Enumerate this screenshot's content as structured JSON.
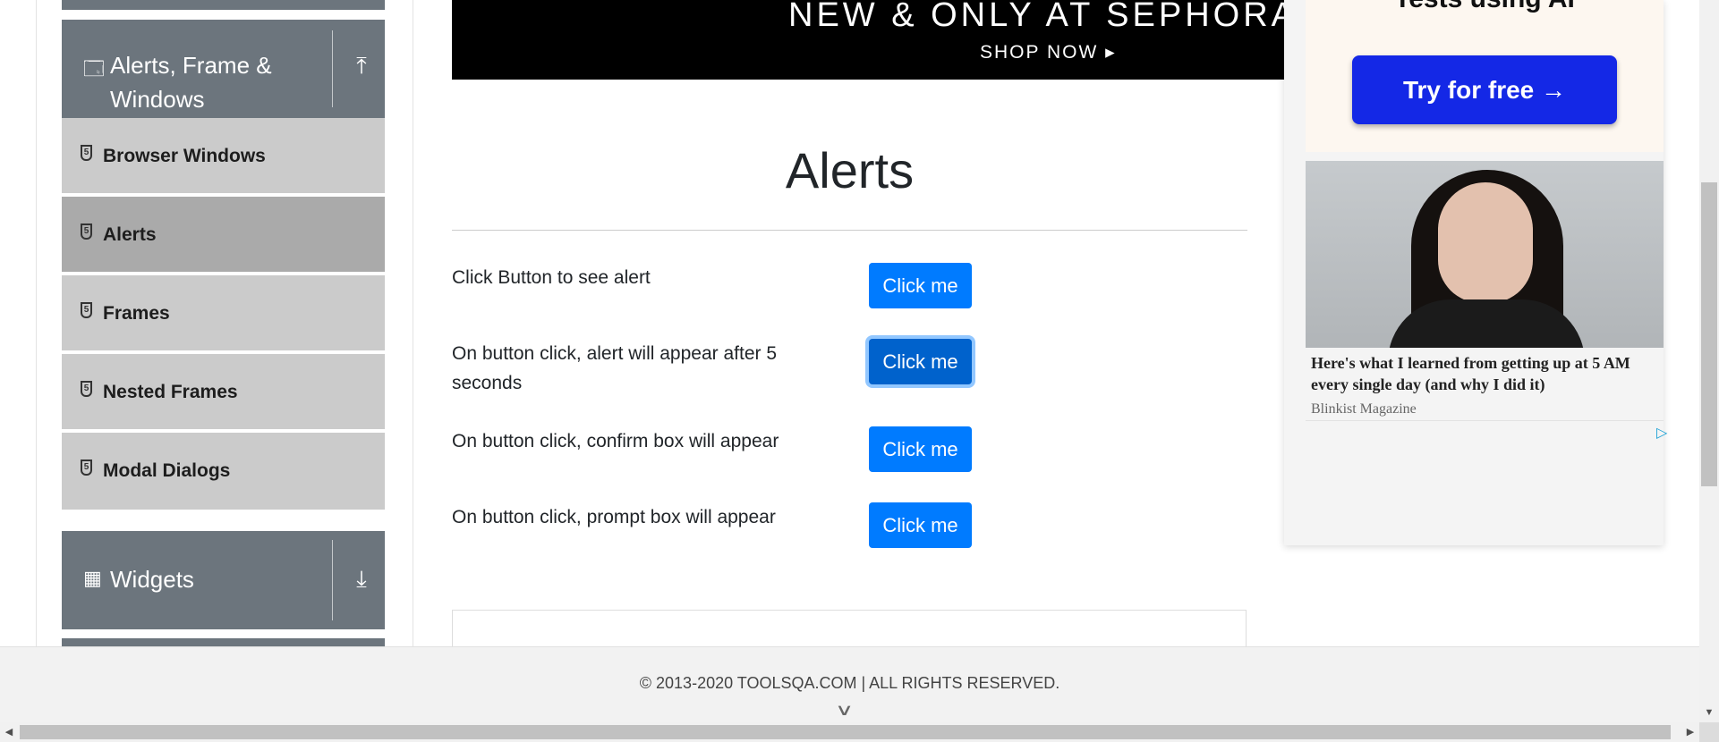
{
  "sidebar": {
    "group_alerts": {
      "label": "Alerts, Frame & Windows",
      "line1": "Alerts, Frame &",
      "line2": "Windows",
      "icon": "window-icon",
      "toggle": "upload-arrow-icon"
    },
    "items": [
      {
        "label": "Browser Windows",
        "icon": "html5-shield-icon",
        "active": false
      },
      {
        "label": "Alerts",
        "icon": "html5-shield-icon",
        "active": true
      },
      {
        "label": "Frames",
        "icon": "html5-shield-icon",
        "active": false
      },
      {
        "label": "Nested Frames",
        "icon": "html5-shield-icon",
        "active": false
      },
      {
        "label": "Modal Dialogs",
        "icon": "html5-shield-icon",
        "active": false
      }
    ],
    "group_widgets": {
      "label": "Widgets",
      "icon": "widgets-icon",
      "toggle": "download-arrow-icon"
    }
  },
  "banner": {
    "line1": "NEW & ONLY AT SEPHORA",
    "line2": "SHOP NOW ▸"
  },
  "main": {
    "title": "Alerts",
    "rows": [
      {
        "text": "Click Button to see alert",
        "button": "Click me"
      },
      {
        "text": "On button click, alert will appear after 5 seconds",
        "button": "Click me"
      },
      {
        "text": "On button click, confirm box will appear",
        "button": "Click me"
      },
      {
        "text": "On button click, prompt box will appear",
        "button": "Click me"
      }
    ]
  },
  "ad": {
    "heading": "Tests using AI",
    "cta": "Try for free →",
    "headline": "Here's what I learned from getting up at 5 AM every single day (and why I did it)",
    "source": "Blinkist Magazine",
    "choice_icon": "adchoices-icon"
  },
  "footer": {
    "text": "© 2013-2020 TOOLSQA.COM | ALL RIGHTS RESERVED."
  },
  "colors": {
    "primary": "#007bff",
    "sidebar_group": "#6c757d",
    "sidebar_item": "#cbcbcb",
    "sidebar_active": "#aaaaaa",
    "ad_cta": "#1428e6"
  }
}
